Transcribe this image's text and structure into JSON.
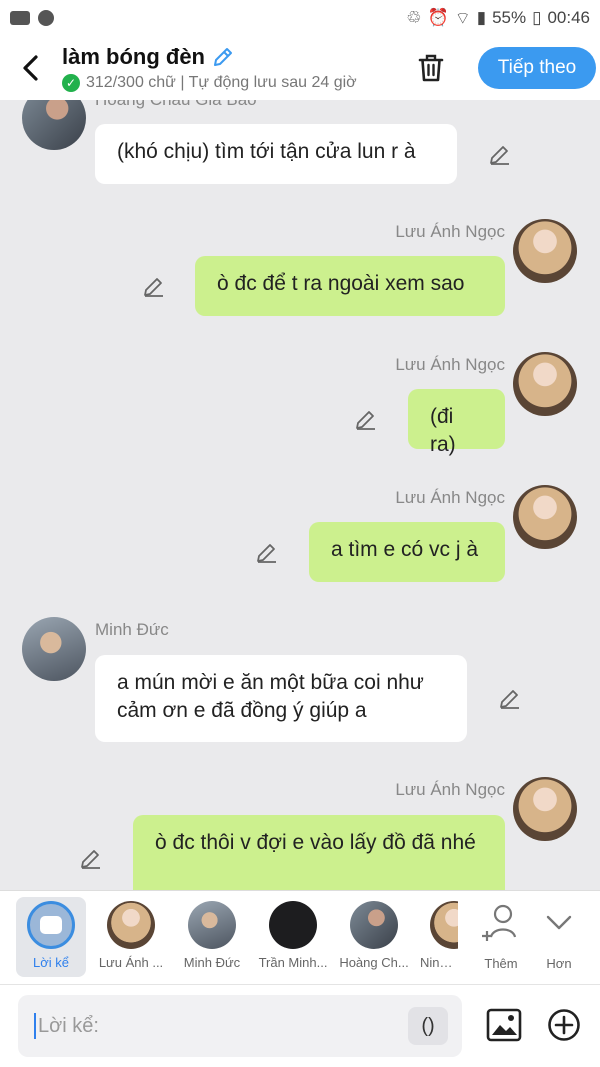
{
  "status": {
    "battery": "55%",
    "time": "00:46"
  },
  "header": {
    "title": "làm bóng đèn",
    "subtitle": "312/300 chữ | Tự động lưu sau 24 giờ",
    "next_label": "Tiếp theo"
  },
  "messages": [
    {
      "sender": "Hoàng Châu Gia Bảo",
      "side": "left",
      "text": "(khó chịu) tìm tới tận cửa lun r à"
    },
    {
      "sender": "Lưu Ánh Ngọc",
      "side": "right",
      "text": "ò đc để t ra ngoài xem sao"
    },
    {
      "sender": "Lưu Ánh Ngọc",
      "side": "right",
      "text": "(đi ra)"
    },
    {
      "sender": "Lưu Ánh Ngọc",
      "side": "right",
      "text": "a tìm e có vc j à"
    },
    {
      "sender": "Minh Đức",
      "side": "left",
      "text": "a mún mời e ăn một bữa coi như cảm ơn e đã đồng ý giúp a"
    },
    {
      "sender": "Lưu Ánh Ngọc",
      "side": "right",
      "text": "ò đc thôi v đợi e vào lấy đồ đã nhé"
    }
  ],
  "members": [
    {
      "label": "Lời kể"
    },
    {
      "label": "Lưu Ánh ..."
    },
    {
      "label": "Minh Đức"
    },
    {
      "label": "Trần Minh..."
    },
    {
      "label": "Hoàng Ch..."
    },
    {
      "label": "Ninh N"
    },
    {
      "label": "Thêm"
    },
    {
      "label": "Hơn"
    }
  ],
  "input": {
    "placeholder": "Lời kể:",
    "paren": "()"
  },
  "colors": {
    "accent": "#3b9af0",
    "bubble_self": "#ccf08e",
    "bubble_other": "#ffffff"
  }
}
